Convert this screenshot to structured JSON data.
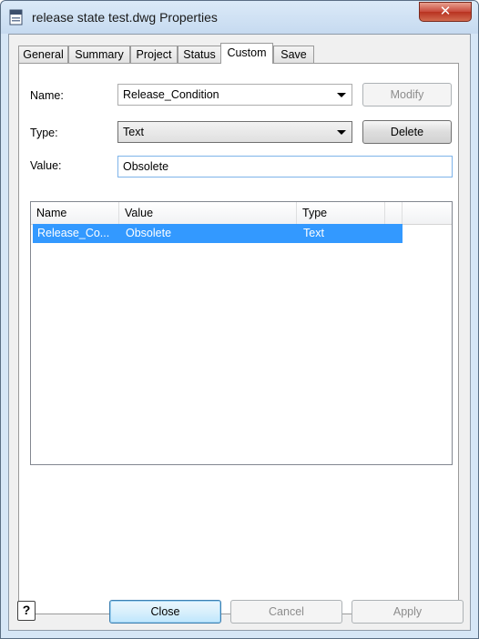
{
  "window": {
    "title": "release state test.dwg Properties",
    "close_glyph": "✕"
  },
  "tabs": [
    {
      "label": "General"
    },
    {
      "label": "Summary"
    },
    {
      "label": "Project"
    },
    {
      "label": "Status"
    },
    {
      "label": "Custom"
    },
    {
      "label": "Save"
    }
  ],
  "active_tab": "Custom",
  "form": {
    "name_label": "Name:",
    "name_value": "Release_Condition",
    "type_label": "Type:",
    "type_value": "Text",
    "value_label": "Value:",
    "value_value": "Obsolete",
    "modify_button": "Modify",
    "delete_button": "Delete"
  },
  "properties_list": {
    "columns": [
      "Name",
      "Value",
      "Type"
    ],
    "rows": [
      {
        "name": "Release_Co...",
        "value": "Obsolete",
        "type": "Text",
        "selected": true
      }
    ]
  },
  "footer": {
    "help_glyph": "?",
    "close_button": "Close",
    "cancel_button": "Cancel",
    "apply_button": "Apply"
  },
  "colors": {
    "selection": "#3399ff",
    "title_bar": "#c6daf0",
    "close_button": "#c7493a"
  }
}
